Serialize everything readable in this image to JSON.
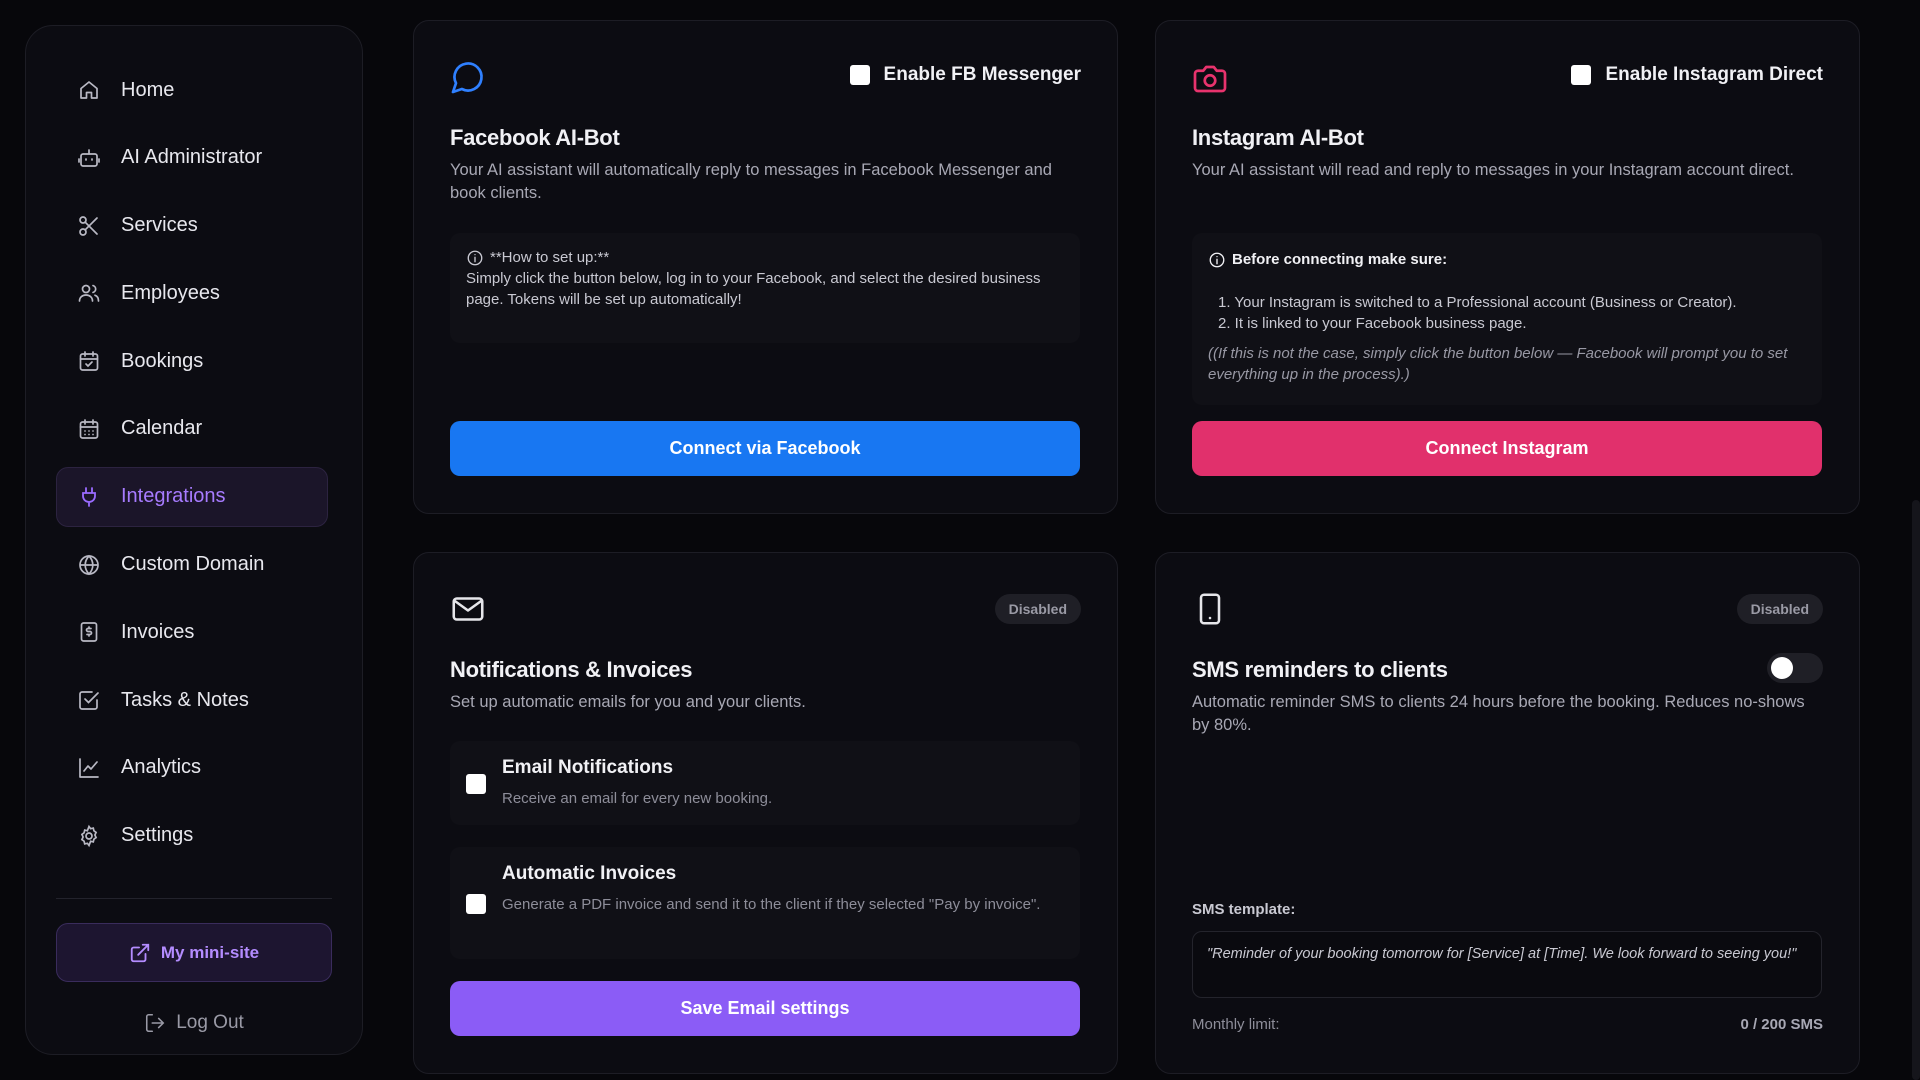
{
  "sidebar": {
    "items": [
      {
        "label": "Home"
      },
      {
        "label": "AI Administrator"
      },
      {
        "label": "Services"
      },
      {
        "label": "Employees"
      },
      {
        "label": "Bookings"
      },
      {
        "label": "Calendar"
      },
      {
        "label": "Integrations",
        "active": true
      },
      {
        "label": "Custom Domain"
      },
      {
        "label": "Invoices"
      },
      {
        "label": "Tasks & Notes"
      },
      {
        "label": "Analytics"
      },
      {
        "label": "Settings"
      }
    ],
    "mini_site_label": "My mini-site",
    "logout_label": "Log Out"
  },
  "facebook": {
    "enable_label": "Enable FB Messenger",
    "title": "Facebook AI-Bot",
    "description": "Your AI assistant will automatically reply to messages in Facebook Messenger and book clients.",
    "info_title": "**How to set up:**",
    "info_text": "Simply click the button below, log in to your Facebook, and select the desired business page. Tokens will be set up automatically!",
    "button_label": "Connect via Facebook"
  },
  "instagram": {
    "enable_label": "Enable Instagram Direct",
    "title": "Instagram AI-Bot",
    "description": "Your AI assistant will read and reply to messages in your Instagram account direct.",
    "info_title": "Before connecting make sure:",
    "steps": [
      "1. Your Instagram is switched to a Professional account (Business or Creator).",
      "2. It is linked to your Facebook business page."
    ],
    "note": "((If this is not the case, simply click the button below — Facebook will prompt you to set everything up in the process).)",
    "button_label": "Connect Instagram"
  },
  "notifications": {
    "badge": "Disabled",
    "title": "Notifications & Invoices",
    "description": "Set up automatic emails for you and your clients.",
    "options": [
      {
        "title": "Email Notifications",
        "description": "Receive an email for every new booking."
      },
      {
        "title": "Automatic Invoices",
        "description": "Generate a PDF invoice and send it to the client if they selected \"Pay by invoice\"."
      }
    ],
    "button_label": "Save Email settings"
  },
  "sms": {
    "badge": "Disabled",
    "title": "SMS reminders to clients",
    "description": "Automatic reminder SMS to clients 24 hours before the booking. Reduces no-shows by 80%.",
    "template_label": "SMS template:",
    "template_text": "\"Reminder of your booking tomorrow for [Service] at [Time]. We look forward to seeing you!\"",
    "limit_label": "Monthly limit:",
    "limit_value": "0 / 200 SMS"
  },
  "colors": {
    "accent": "#8b5cf6",
    "facebook_blue": "#1877f2",
    "instagram_pink": "#e1306c"
  }
}
